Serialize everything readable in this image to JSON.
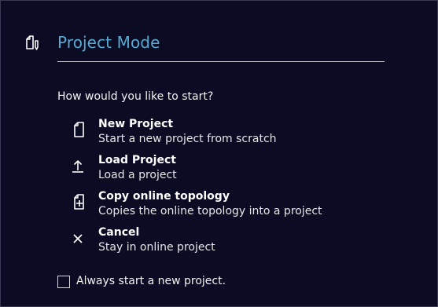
{
  "dialog": {
    "title": "Project Mode",
    "header_icon": "project-mode-icon",
    "question": "How would you like to start?",
    "accent_color": "#58a9d1",
    "background_color": "#0b0b23"
  },
  "options": [
    {
      "title": "New Project",
      "description": "Start a new project from scratch",
      "icon": "new-file-icon"
    },
    {
      "title": "Load Project",
      "description": "Load a project",
      "icon": "upload-icon"
    },
    {
      "title": "Copy online topology",
      "description": "Copies the online topology into a project",
      "icon": "file-add-icon"
    },
    {
      "title": "Cancel",
      "description": "Stay in online project",
      "icon": "close-icon"
    }
  ],
  "checkbox": {
    "label": "Always start a new project.",
    "checked": false
  }
}
